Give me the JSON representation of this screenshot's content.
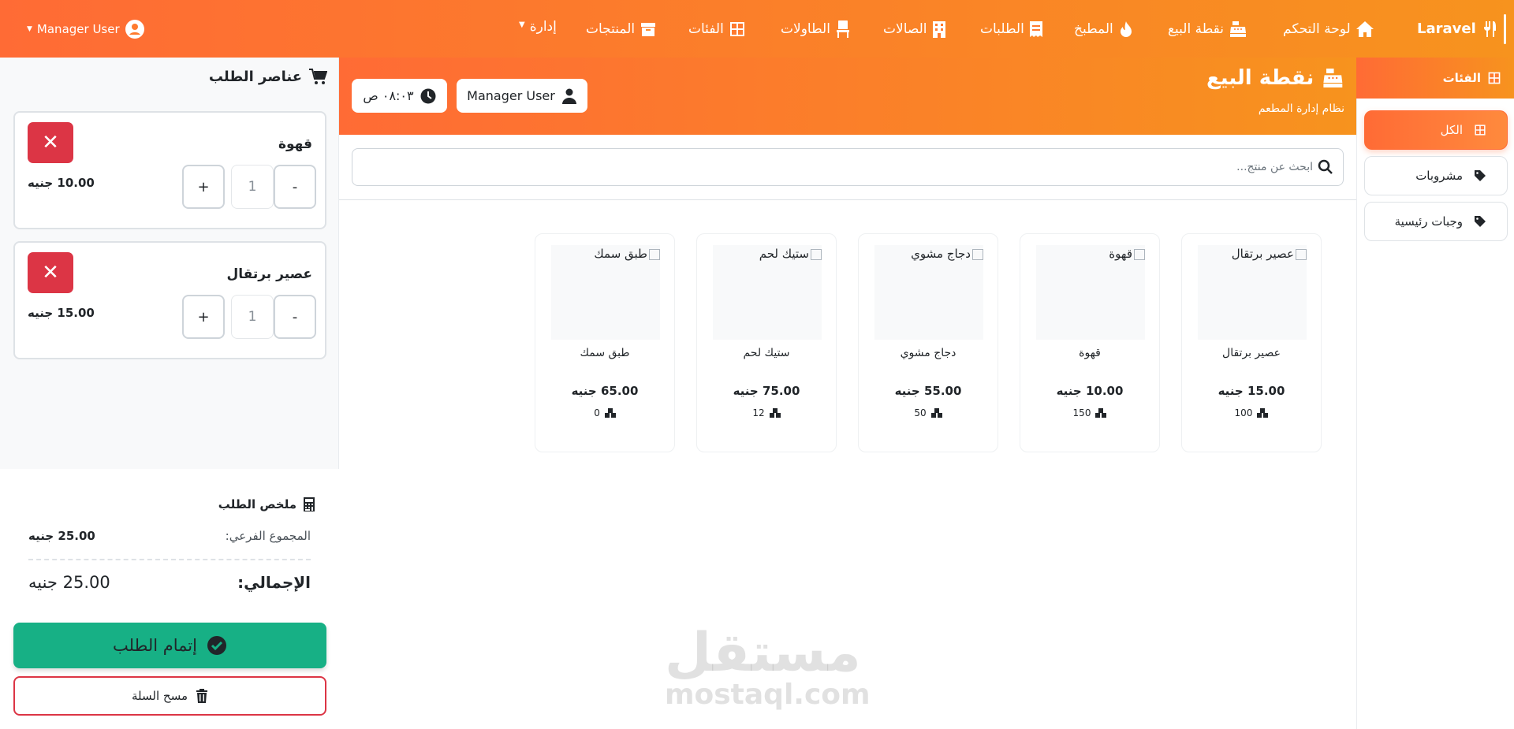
{
  "nav": {
    "brand": "Laravel",
    "items": [
      {
        "label": "لوحة التحكم",
        "icon": "home-icon"
      },
      {
        "label": "نقطة البيع",
        "icon": "cash-register-icon"
      },
      {
        "label": "المطبخ",
        "icon": "fire-icon"
      },
      {
        "label": "الطلبات",
        "icon": "receipt-icon"
      },
      {
        "label": "الصالات",
        "icon": "building-icon"
      },
      {
        "label": "الطاولات",
        "icon": "chair-icon"
      },
      {
        "label": "الفئات",
        "icon": "grid-icon"
      },
      {
        "label": "المنتجات",
        "icon": "box-icon"
      },
      {
        "label": "إدارة",
        "icon": "caret-down-icon"
      }
    ],
    "user": "Manager User"
  },
  "categories": {
    "title": "الفئات",
    "items": [
      {
        "label": "الكل",
        "icon": "grid-icon",
        "active": true
      },
      {
        "label": "مشروبات",
        "icon": "tag-icon",
        "active": false
      },
      {
        "label": "وجبات رئيسية",
        "icon": "tag-icon",
        "active": false
      }
    ]
  },
  "header": {
    "title": "نقطة البيع",
    "subtitle": "نظام إدارة المطعم",
    "user": "Manager User",
    "time": "٠٨:٠٣ ص"
  },
  "search": {
    "placeholder": "ابحث عن منتج..."
  },
  "products": [
    {
      "name": "عصير برتقال",
      "price": "15.00 جنيه",
      "stock": "100"
    },
    {
      "name": "قهوة",
      "price": "10.00 جنيه",
      "stock": "150"
    },
    {
      "name": "دجاج مشوي",
      "price": "55.00 جنيه",
      "stock": "50"
    },
    {
      "name": "ستيك لحم",
      "price": "75.00 جنيه",
      "stock": "12"
    },
    {
      "name": "طبق سمك",
      "price": "65.00 جنيه",
      "stock": "0"
    }
  ],
  "order": {
    "title": "عناصر الطلب",
    "items": [
      {
        "name": "قهوة",
        "qty": "1",
        "price": "10.00 جنيه"
      },
      {
        "name": "عصير برتقال",
        "qty": "1",
        "price": "15.00 جنيه"
      }
    ],
    "minus": "-",
    "plus": "+",
    "remove": "✕"
  },
  "summary": {
    "title": "ملخص الطلب",
    "subtotal_label": "المجموع الفرعي:",
    "subtotal": "25.00 جنيه",
    "total_label": "الإجمالي:",
    "total": "25.00 جنيه",
    "complete": "إتمام الطلب",
    "clear": "مسح السلة"
  },
  "watermark": {
    "ar": "مستقل",
    "en": "mostaql.com"
  },
  "colors": {
    "primary": "#ff6b35",
    "secondary": "#f7931e",
    "success": "#17b085",
    "danger": "#dc3545"
  }
}
